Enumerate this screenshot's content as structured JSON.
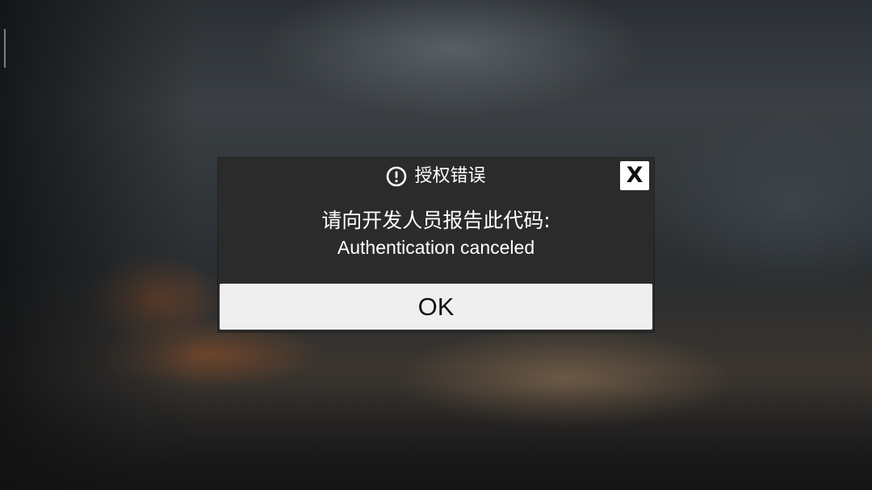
{
  "dialog": {
    "title": "授权错误",
    "title_icon": "alert-circle-icon",
    "close_label": "X",
    "message_line1": "请向开发人员报告此代码:",
    "message_line2": "Authentication canceled",
    "ok_label": "OK"
  },
  "colors": {
    "dialog_background": "#2b2b2b",
    "button_background": "#efefef",
    "text_light": "#ffffff",
    "text_dark": "#111111"
  }
}
